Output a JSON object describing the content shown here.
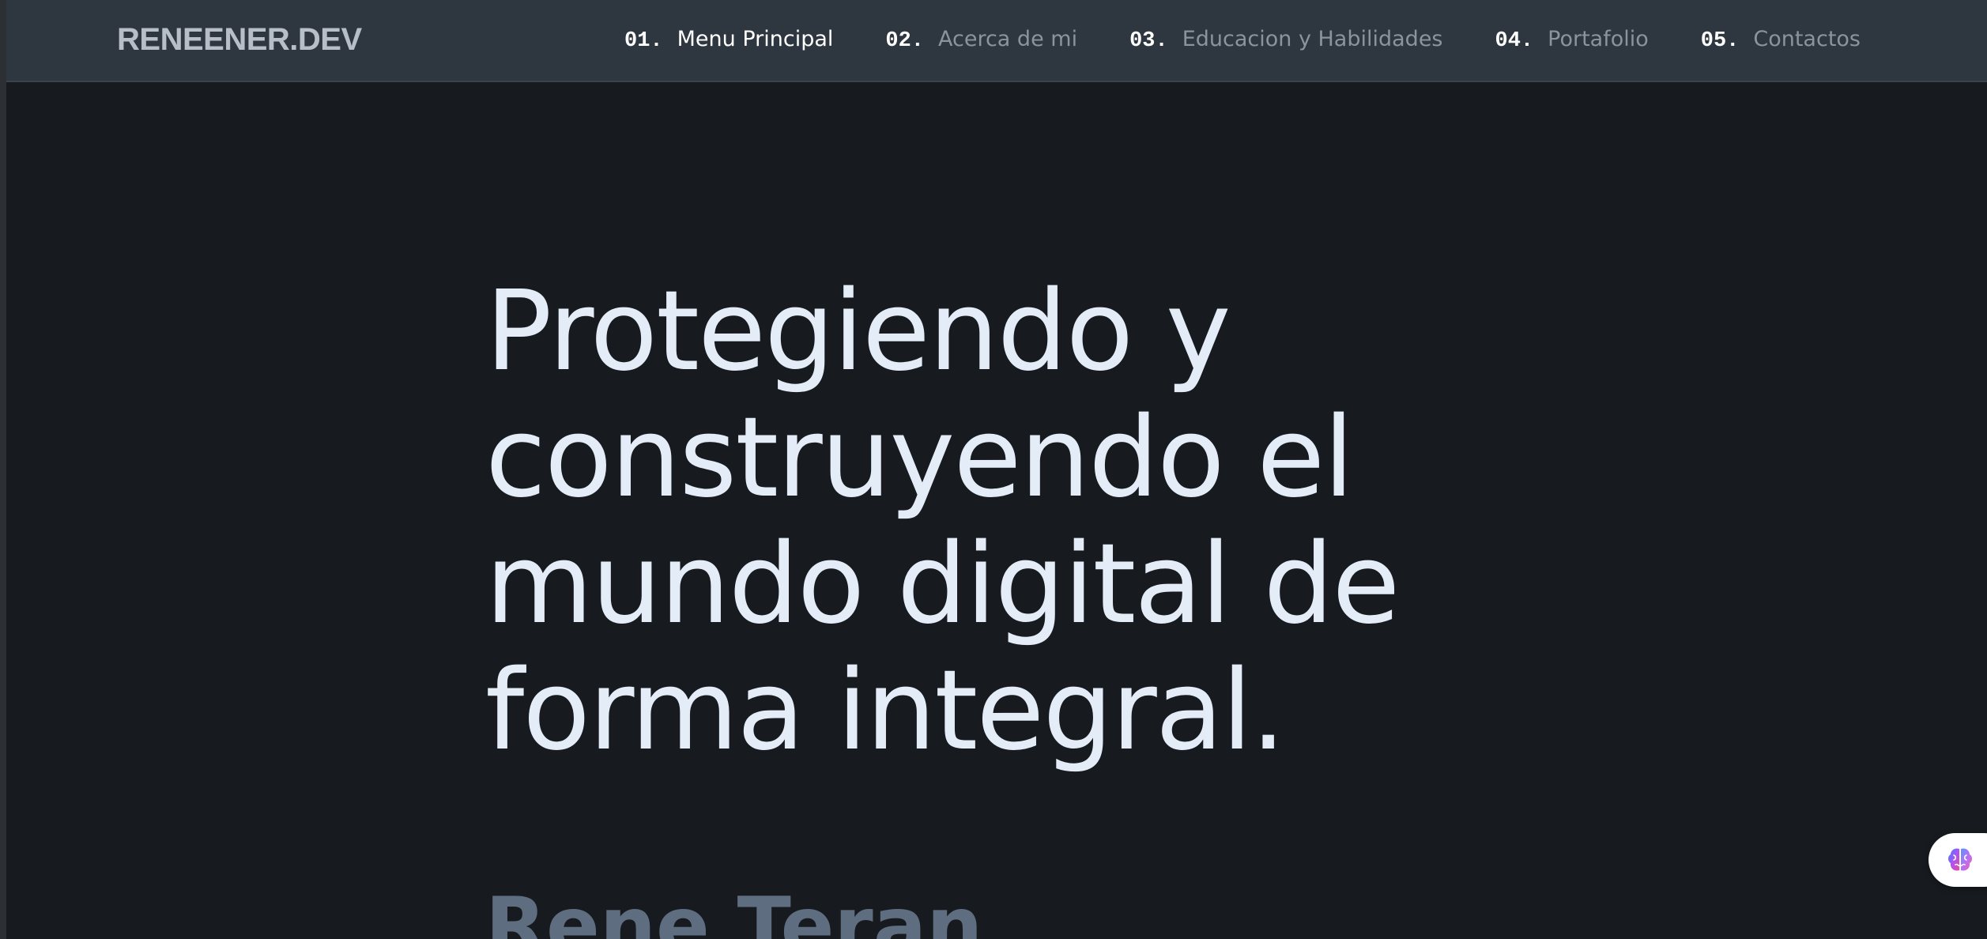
{
  "header": {
    "logo": "RENEENER.DEV"
  },
  "nav": {
    "items": [
      {
        "num": "01.",
        "label": "Menu Principal",
        "active": true
      },
      {
        "num": "02.",
        "label": "Acerca de mi"
      },
      {
        "num": "03.",
        "label": "Educacion y Habilidades"
      },
      {
        "num": "04.",
        "label": "Portafolio"
      },
      {
        "num": "05.",
        "label": "Contactos"
      }
    ]
  },
  "hero": {
    "title_lines": [
      "Protegiendo y",
      "construyendo el",
      "mundo digital de",
      "forma integral."
    ],
    "name": "Rene Teran"
  },
  "widget": {
    "icon": "brain-icon"
  },
  "colors": {
    "background": "#171b1f",
    "navbar": "#2e3740",
    "hero_text": "#e4ecf8",
    "name_text": "#5f6d80"
  }
}
